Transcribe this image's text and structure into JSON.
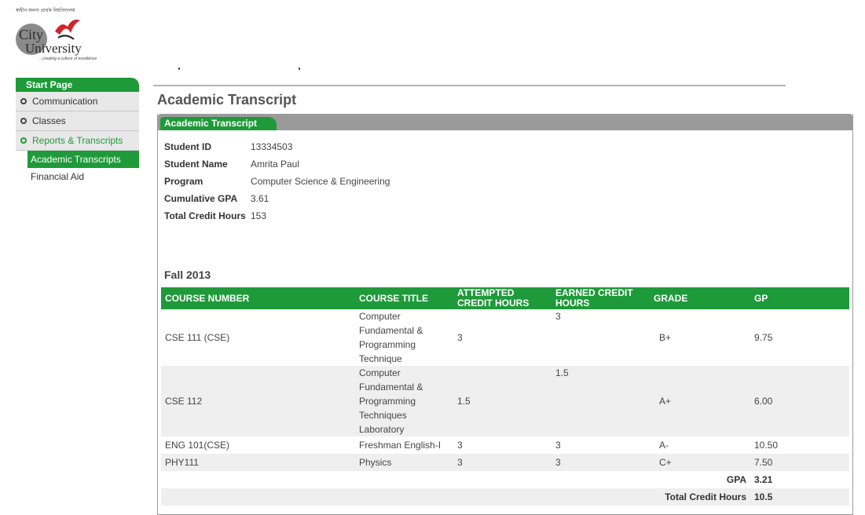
{
  "logo": {
    "tagline_top": "স্বাধীন অনন্য প্রার্থক বিশ্ববিদ্যালয়",
    "city": "City",
    "university": "University",
    "subtitle": "...creating a culture of excellence"
  },
  "sidebar": {
    "header": "Start Page",
    "items": [
      {
        "label": "Communication"
      },
      {
        "label": "Classes"
      },
      {
        "label": "Reports & Transcripts"
      }
    ],
    "subitems": [
      {
        "label": "Academic Transcripts"
      },
      {
        "label": "Financial Aid"
      }
    ]
  },
  "page": {
    "title": "Academic Transcript",
    "panel_tab": "Academic Transcript"
  },
  "student": {
    "fields": [
      {
        "label": "Student ID",
        "value": "13334503"
      },
      {
        "label": "Student Name",
        "value": "Amrita Paul"
      },
      {
        "label": "Program",
        "value": "Computer Science & Engineering"
      },
      {
        "label": "Cumulative GPA",
        "value": "3.61"
      },
      {
        "label": "Total Credit Hours",
        "value": "153"
      }
    ]
  },
  "term": {
    "name": "Fall 2013",
    "columns": [
      "COURSE NUMBER",
      "COURSE TITLE",
      "ATTEMPTED CREDIT HOURS",
      "EARNED CREDIT HOURS",
      "GRADE",
      "GP"
    ],
    "rows": [
      {
        "course_number": "CSE 111 (CSE)",
        "title": "Computer Fundamental & Programming Technique",
        "attempted": "3",
        "earned": "3",
        "grade": "B+",
        "gp": "9.75"
      },
      {
        "course_number": "CSE 112",
        "title": "Computer Fundamental & Programming Techniques Laboratory",
        "attempted": "1.5",
        "earned": "1.5",
        "grade": "A+",
        "gp": "6.00"
      },
      {
        "course_number": "ENG 101(CSE)",
        "title": "Freshman English-I",
        "attempted": "3",
        "earned": "3",
        "grade": "A-",
        "gp": "10.50"
      },
      {
        "course_number": "PHY111",
        "title": "Physics",
        "attempted": "3",
        "earned": "3",
        "grade": "C+",
        "gp": "7.50"
      }
    ],
    "gpa_label": "GPA",
    "gpa_value": "3.21",
    "tch_label": "Total Credit Hours",
    "tch_value": "10.5"
  },
  "colors": {
    "accent_green": "#1f9a3a",
    "panel_gray": "#9a9a9a"
  }
}
